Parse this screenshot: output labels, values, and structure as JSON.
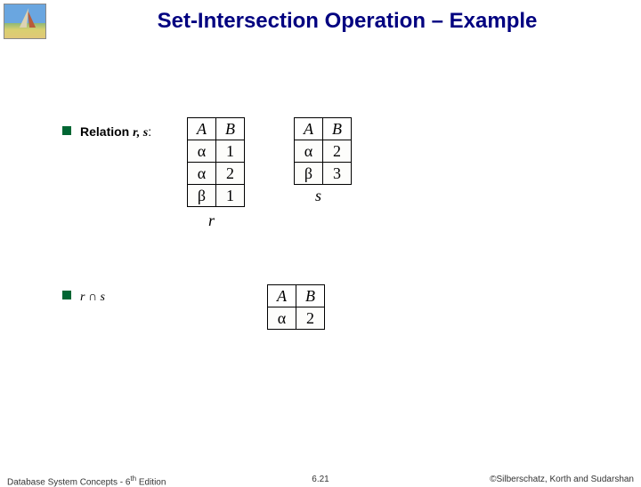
{
  "title": "Set-Intersection Operation – Example",
  "bullet1_label": "Relation ",
  "bullet1_vars": "r, s",
  "bullet1_suffix": ":",
  "bullet2_expr": "r ∩ s",
  "table_r": {
    "headers": [
      "A",
      "B"
    ],
    "rows": [
      [
        "α",
        "1"
      ],
      [
        "α",
        "2"
      ],
      [
        "β",
        "1"
      ]
    ],
    "caption": "r"
  },
  "table_s": {
    "headers": [
      "A",
      "B"
    ],
    "rows": [
      [
        "α",
        "2"
      ],
      [
        "β",
        "3"
      ]
    ],
    "caption": "s"
  },
  "table_result": {
    "headers": [
      "A",
      "B"
    ],
    "rows": [
      [
        "α",
        "2"
      ]
    ]
  },
  "footer": {
    "left_prefix": "Database System Concepts - 6",
    "left_sup": "th",
    "left_suffix": " Edition",
    "center": "6.21",
    "right": "©Silberschatz, Korth and Sudarshan"
  }
}
